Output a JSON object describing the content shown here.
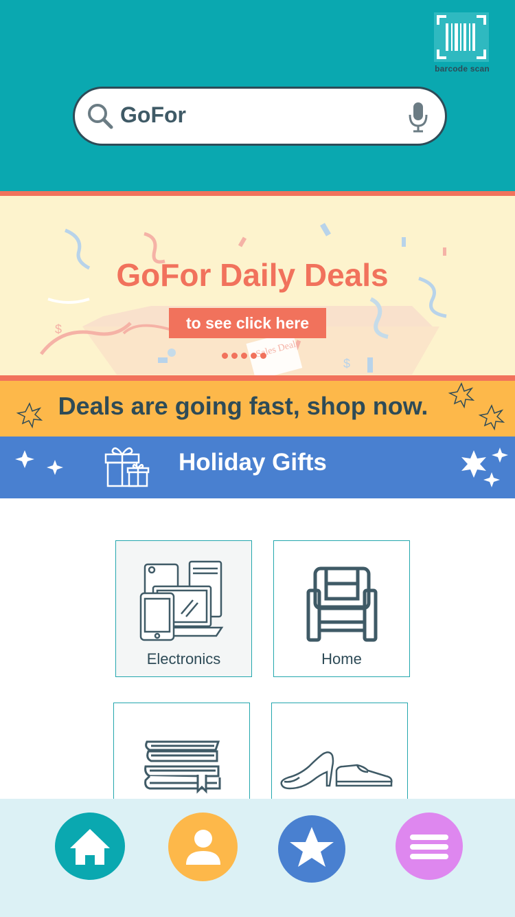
{
  "header": {
    "barcode_label": "barcode scan",
    "search": {
      "value": "GoFor"
    }
  },
  "banner": {
    "title": "GoFor Daily Deals",
    "button_label": "to see click here",
    "carousel_dots": 5,
    "box_text": "Sales Deals"
  },
  "promo_strip": {
    "text": "Deals are going fast, shop now."
  },
  "holiday": {
    "text": "Holiday Gifts"
  },
  "categories": [
    {
      "label": "Electronics",
      "icon": "electronics-icon"
    },
    {
      "label": "Home",
      "icon": "armchair-icon"
    },
    {
      "label": "",
      "icon": "books-icon"
    },
    {
      "label": "",
      "icon": "shoes-icon"
    }
  ],
  "bottom_nav": [
    {
      "name": "home",
      "icon": "home-icon",
      "color": "#0aa8b0"
    },
    {
      "name": "profile",
      "icon": "user-icon",
      "color": "#fdb84a"
    },
    {
      "name": "favorites",
      "icon": "star-icon",
      "color": "#4980d0"
    },
    {
      "name": "menu",
      "icon": "menu-icon",
      "color": "#de87ef"
    }
  ],
  "colors": {
    "teal": "#0aa8b0",
    "coral": "#f1725c",
    "cream": "#fdf3cd",
    "orange": "#fdb84a",
    "blue": "#4980d0",
    "dark": "#2e4b57"
  }
}
